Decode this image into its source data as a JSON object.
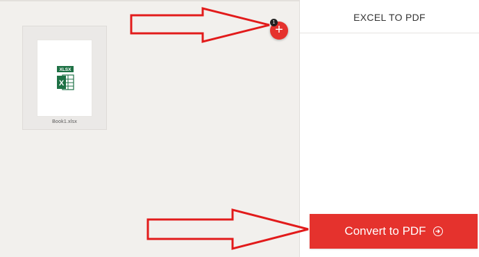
{
  "sidebar": {
    "title": "EXCEL TO PDF"
  },
  "file": {
    "name": "Book1.xlsx",
    "type_label": "XLSX"
  },
  "add_files": {
    "count": "1",
    "symbol": "+"
  },
  "convert": {
    "label": "Convert to PDF"
  },
  "colors": {
    "accent": "#e5322d",
    "excel_green": "#1e7145",
    "annotation_arrow": "#e21b1b"
  },
  "icons": {
    "file_type": "xlsx-file-icon",
    "add": "plus-icon",
    "convert": "arrow-right-circle-icon"
  }
}
